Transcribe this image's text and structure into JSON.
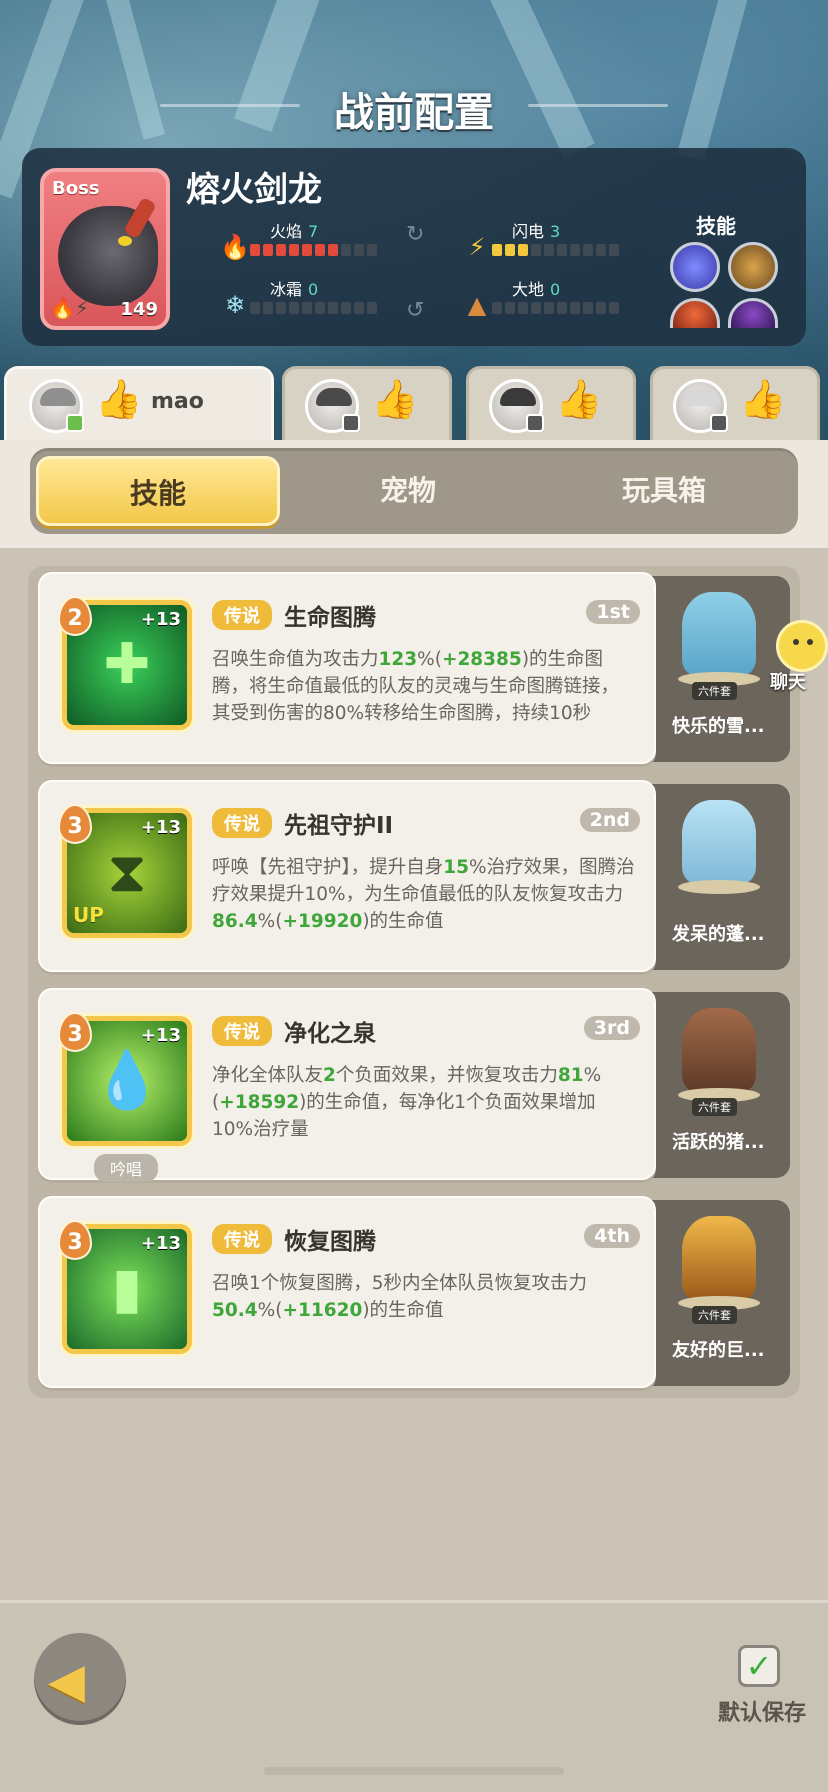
{
  "page_title": "战前配置",
  "boss": {
    "tag": "Boss",
    "name": "熔火剑龙",
    "level": "149",
    "stats": [
      {
        "label": "火焰",
        "value": "7",
        "max": 10,
        "color": "#e24b3a",
        "icon": "flame-icon"
      },
      {
        "label": "闪电",
        "value": "3",
        "max": 10,
        "color": "#f2c93b",
        "icon": "lightning-icon"
      },
      {
        "label": "冰霜",
        "value": "0",
        "max": 10,
        "color": "#5ed9c8",
        "icon": "snowflake-icon"
      },
      {
        "label": "大地",
        "value": "0",
        "max": 10,
        "color": "#d98a3a",
        "icon": "earth-icon"
      }
    ],
    "skills_label": "技能"
  },
  "players": [
    {
      "name": "mao",
      "active": true
    },
    {
      "name": "",
      "active": false
    },
    {
      "name": "",
      "active": false
    },
    {
      "name": "",
      "active": false
    }
  ],
  "tabs": [
    "技能",
    "宠物",
    "玩具箱"
  ],
  "active_tab": "技能",
  "skills": [
    {
      "level": "2",
      "plus": "+13",
      "tag": "传说",
      "name": "生命图腾",
      "rank": "1st",
      "desc_parts": [
        {
          "t": "召唤生命值为攻击力"
        },
        {
          "t": "123",
          "hl": true
        },
        {
          "t": "%("
        },
        {
          "t": "+28385",
          "hl": true
        },
        {
          "t": ")的生命图腾，将生命值最低的队友的灵魂与生命图腾链接，其受到伤害的80%转移给生命图腾，持续10秒"
        }
      ],
      "pet_tag": "六件套",
      "pet_name": "快乐的雪...",
      "extra": ""
    },
    {
      "level": "3",
      "plus": "+13",
      "tag": "传说",
      "name": "先祖守护II",
      "rank": "2nd",
      "desc_parts": [
        {
          "t": "呼唤【先祖守护】，提升自身"
        },
        {
          "t": "15",
          "hl": true
        },
        {
          "t": "%治疗效果，图腾治疗效果提升10%，为生命值最低的队友恢复攻击力"
        },
        {
          "t": "86.4",
          "hl": true
        },
        {
          "t": "%("
        },
        {
          "t": "+19920",
          "hl": true
        },
        {
          "t": ")的生命值"
        }
      ],
      "pet_tag": "",
      "pet_name": "发呆的蓬...",
      "extra": "UP"
    },
    {
      "level": "3",
      "plus": "+13",
      "tag": "传说",
      "name": "净化之泉",
      "rank": "3rd",
      "desc_parts": [
        {
          "t": "净化全体队友"
        },
        {
          "t": "2",
          "hl": true
        },
        {
          "t": "个负面效果，并恢复攻击力"
        },
        {
          "t": "81",
          "hl": true
        },
        {
          "t": "%("
        },
        {
          "t": "+18592",
          "hl": true
        },
        {
          "t": ")的生命值，每净化1个负面效果增加10%治疗量"
        }
      ],
      "pet_tag": "六件套",
      "pet_name": "活跃的猪...",
      "extra": "吟唱"
    },
    {
      "level": "3",
      "plus": "+13",
      "tag": "传说",
      "name": "恢复图腾",
      "rank": "4th",
      "desc_parts": [
        {
          "t": "召唤1个恢复图腾，5秒内全体队员恢复攻击力"
        },
        {
          "t": "50.4",
          "hl": true
        },
        {
          "t": "%("
        },
        {
          "t": "+11620",
          "hl": true
        },
        {
          "t": ")的生命值"
        }
      ],
      "pet_tag": "六件套",
      "pet_name": "友好的巨...",
      "extra": ""
    }
  ],
  "chat_label": "聊天",
  "save_label": "默认保存",
  "colors": {
    "accent": "#f3c84a",
    "highlight": "#3fa63a"
  }
}
